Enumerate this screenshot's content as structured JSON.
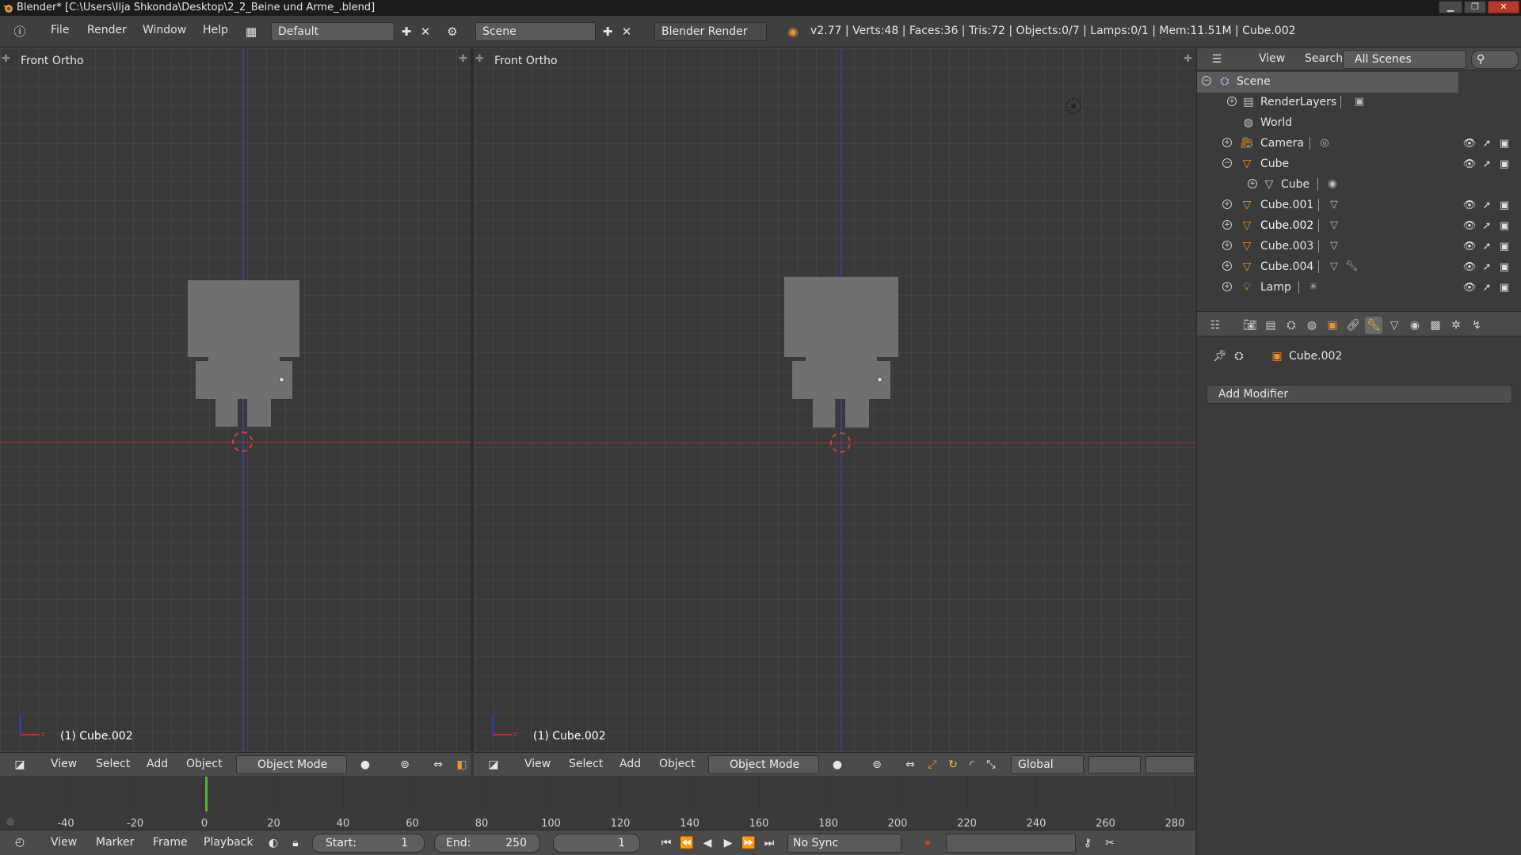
{
  "window": {
    "title": "Blender* [C:\\Users\\Ilja Shkonda\\Desktop\\2_2_Beine und Arme_.blend]"
  },
  "infobar": {
    "menus": [
      "File",
      "Render",
      "Window",
      "Help"
    ],
    "screen_layout": "Default",
    "scene": "Scene",
    "render_engine": "Blender Render",
    "stats": "v2.77 | Verts:48 | Faces:36 | Tris:72 | Objects:0/7 | Lamps:0/1 | Mem:11.51M | Cube.002"
  },
  "viewports": {
    "left": {
      "label": "Front Ortho",
      "object": "(1) Cube.002"
    },
    "right": {
      "label": "Front Ortho",
      "object": "(1) Cube.002"
    }
  },
  "view3d_header": {
    "menus": [
      "View",
      "Select",
      "Add",
      "Object"
    ],
    "mode": "Object Mode",
    "orientation": "Global"
  },
  "timeline": {
    "ticks": [
      "-40",
      "-20",
      "0",
      "20",
      "40",
      "60",
      "80",
      "100",
      "120",
      "140",
      "160",
      "180",
      "200",
      "220",
      "240",
      "260",
      "280"
    ],
    "current_frame": "1"
  },
  "timeline_header": {
    "menus": [
      "View",
      "Marker",
      "Frame",
      "Playback"
    ],
    "start_label": "Start:",
    "start_value": "1",
    "end_label": "End:",
    "end_value": "250",
    "frame_value": "1",
    "sync": "No Sync"
  },
  "outliner": {
    "menus": [
      "View",
      "Search"
    ],
    "filter": "All Scenes",
    "items": [
      {
        "label": "Scene",
        "icon": "scene-icon"
      },
      {
        "label": "RenderLayers",
        "icon": "renderlayers-icon"
      },
      {
        "label": "World",
        "icon": "world-icon"
      },
      {
        "label": "Camera",
        "icon": "camera-icon"
      },
      {
        "label": "Cube",
        "icon": "mesh-object-icon"
      },
      {
        "label": "Cube",
        "icon": "mesh-data-icon"
      },
      {
        "label": "Cube.001",
        "icon": "mesh-object-icon"
      },
      {
        "label": "Cube.002",
        "icon": "mesh-object-icon"
      },
      {
        "label": "Cube.003",
        "icon": "mesh-object-icon"
      },
      {
        "label": "Cube.004",
        "icon": "mesh-object-icon"
      },
      {
        "label": "Lamp",
        "icon": "lamp-icon"
      }
    ]
  },
  "properties": {
    "object_name": "Cube.002",
    "add_modifier": "Add Modifier"
  },
  "colors": {
    "accent_orange": "#e8932d",
    "axis_z_blue": "#3b3bb0",
    "axis_x_red": "#9a3a3a",
    "current_frame_green": "#4dbb2a"
  }
}
